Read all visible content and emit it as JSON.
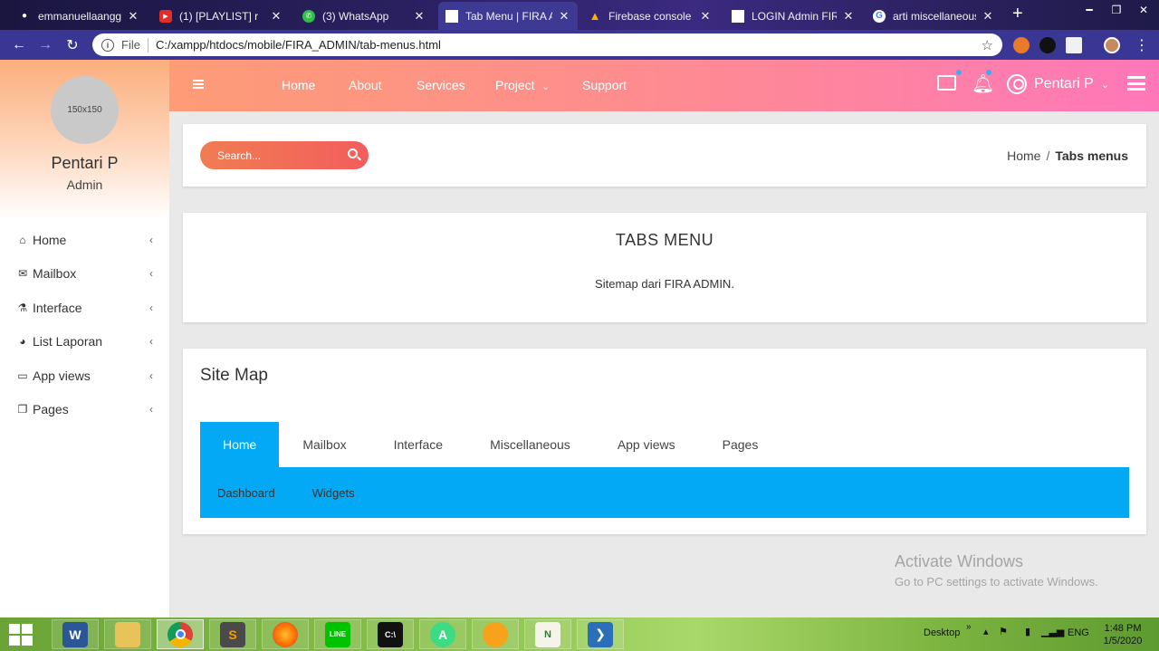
{
  "browser": {
    "tabs": [
      {
        "title": "emmanuellaanggi/",
        "favicon": "github-icon",
        "active": false
      },
      {
        "title": "(1) [PLAYLIST] r",
        "favicon": "youtube-icon",
        "active": false
      },
      {
        "title": "(3) WhatsApp",
        "favicon": "whatsapp-icon",
        "active": false
      },
      {
        "title": "Tab Menu | FIRA AD",
        "favicon": "page-icon",
        "active": true
      },
      {
        "title": "Firebase console",
        "favicon": "firebase-icon",
        "active": false
      },
      {
        "title": "LOGIN Admin FIRA",
        "favicon": "page-icon",
        "active": false
      },
      {
        "title": "arti miscellaneous",
        "favicon": "google-icon",
        "active": false
      }
    ],
    "url_scheme": "File",
    "url": "C:/xampp/htdocs/mobile/FIRA_ADMIN/tab-menus.html"
  },
  "sidebar": {
    "avatar_text": "150x150",
    "user_name": "Pentari P",
    "user_role": "Admin",
    "items": [
      {
        "label": "Home",
        "icon": "home-icon",
        "glyph": "⌂"
      },
      {
        "label": "Mailbox",
        "icon": "envelope-icon",
        "glyph": "✉"
      },
      {
        "label": "Interface",
        "icon": "flask-icon",
        "glyph": "⚗"
      },
      {
        "label": "List Laporan",
        "icon": "pie-chart-icon",
        "glyph": "◕"
      },
      {
        "label": "App views",
        "icon": "desktop-icon",
        "glyph": "▭"
      },
      {
        "label": "Pages",
        "icon": "copy-icon",
        "glyph": "❐"
      }
    ]
  },
  "topbar": {
    "nav": [
      "Home",
      "About",
      "Services",
      "Project",
      "Support"
    ],
    "user_name": "Pentari P"
  },
  "search": {
    "placeholder": "Search..."
  },
  "breadcrumb": {
    "home": "Home",
    "separator": "/",
    "current": "Tabs menus"
  },
  "tabs_menu": {
    "title": "TABS MENU",
    "subtitle": "Sitemap dari FIRA ADMIN."
  },
  "site_map": {
    "title": "Site Map",
    "tabs": [
      "Home",
      "Mailbox",
      "Interface",
      "Miscellaneous",
      "App views",
      "Pages"
    ],
    "active_tab": "Home",
    "subtabs": [
      "Dashboard",
      "Widgets"
    ]
  },
  "watermark": {
    "line1": "Activate Windows",
    "line2": "Go to PC settings to activate Windows."
  },
  "taskbar": {
    "desktop_label": "Desktop",
    "language": "ENG",
    "time": "1:48 PM",
    "date": "1/5/2020"
  },
  "colors": {
    "accent_blue": "#03a9f4",
    "topbar_start": "#fd9c76",
    "topbar_end": "#ff77b9",
    "search": "#f07d52"
  }
}
